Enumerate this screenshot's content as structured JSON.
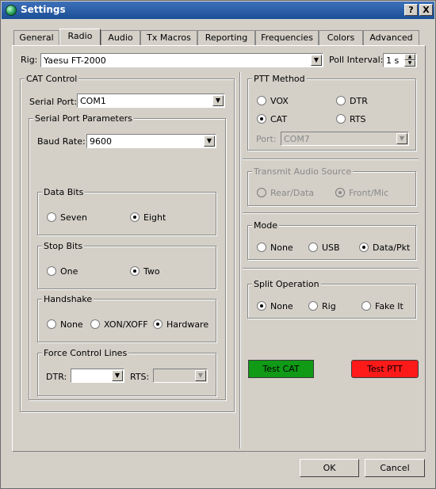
{
  "window": {
    "title": "Settings",
    "help_label": "?",
    "close_label": "X"
  },
  "tabs": [
    "General",
    "Radio",
    "Audio",
    "Tx Macros",
    "Reporting",
    "Frequencies",
    "Colors",
    "Advanced"
  ],
  "rig": {
    "label": "Rig:",
    "value": "Yaesu FT-2000"
  },
  "poll": {
    "label": "Poll Interval:",
    "value": "1 s"
  },
  "cat_control": {
    "title": "CAT Control",
    "serial_port_label": "Serial Port:",
    "serial_port_value": "COM1",
    "params_title": "Serial Port Parameters",
    "baud_label": "Baud Rate:",
    "baud_value": "9600",
    "data_bits": {
      "title": "Data Bits",
      "options": [
        "Seven",
        "Eight"
      ],
      "selected": "Eight"
    },
    "stop_bits": {
      "title": "Stop Bits",
      "options": [
        "One",
        "Two"
      ],
      "selected": "Two"
    },
    "handshake": {
      "title": "Handshake",
      "options": [
        "None",
        "XON/XOFF",
        "Hardware"
      ],
      "selected": "Hardware"
    },
    "force_lines": {
      "title": "Force Control Lines",
      "dtr_label": "DTR:",
      "dtr_value": "",
      "rts_label": "RTS:",
      "rts_value": ""
    }
  },
  "ptt_method": {
    "title": "PTT Method",
    "options": [
      "VOX",
      "DTR",
      "CAT",
      "RTS"
    ],
    "selected": "CAT",
    "port_label": "Port:",
    "port_value": "COM7"
  },
  "tx_audio": {
    "title": "Transmit Audio Source",
    "options": [
      "Rear/Data",
      "Front/Mic"
    ],
    "selected": "Front/Mic"
  },
  "mode": {
    "title": "Mode",
    "options": [
      "None",
      "USB",
      "Data/Pkt"
    ],
    "selected": "Data/Pkt"
  },
  "split": {
    "title": "Split Operation",
    "options": [
      "None",
      "Rig",
      "Fake It"
    ],
    "selected": "None"
  },
  "buttons": {
    "test_cat": "Test CAT",
    "test_ptt": "Test PTT",
    "ok": "OK",
    "cancel": "Cancel"
  },
  "colors": {
    "test_cat_bg": "#109a16",
    "test_ptt_bg": "#ff1a1a",
    "titlebar": "#2a5ea8"
  }
}
